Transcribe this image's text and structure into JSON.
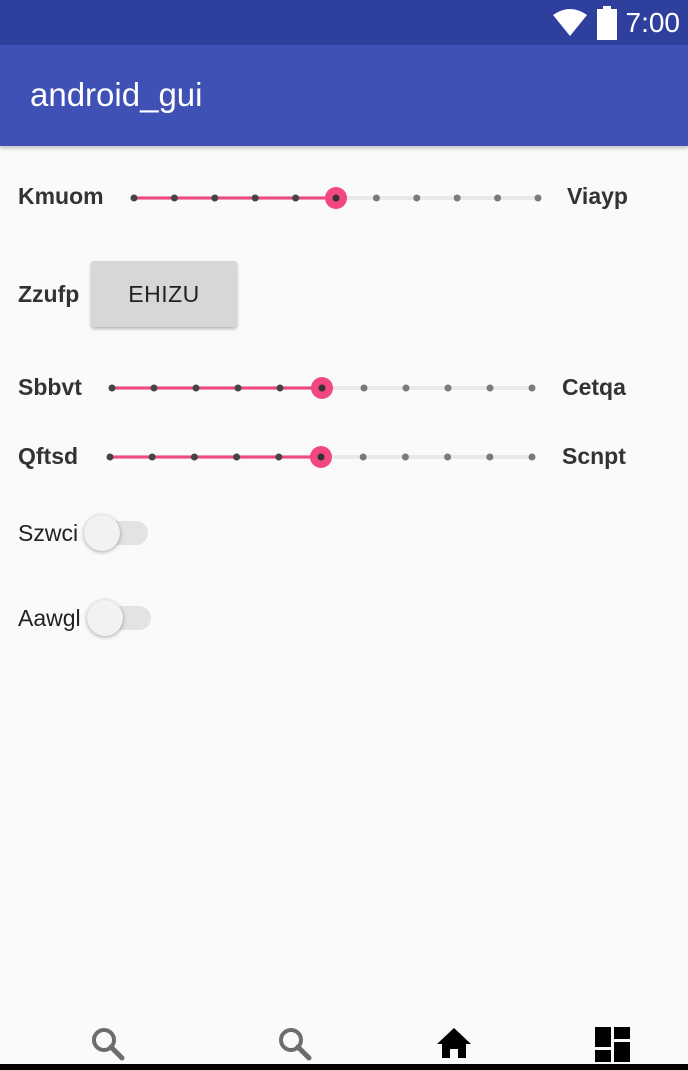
{
  "status_bar": {
    "time": "7:00",
    "icons": [
      "wifi-icon",
      "battery-icon"
    ]
  },
  "app_bar": {
    "title": "android_gui",
    "color": "#3f51b5"
  },
  "controls": {
    "slider_1": {
      "start_label": "Kmuom",
      "end_label": "Viayp",
      "steps": 10,
      "value": 5
    },
    "button_row": {
      "label": "Zzufp",
      "button_text": "EHIZU"
    },
    "slider_2": {
      "start_label": "Sbbvt",
      "end_label": "Cetqa",
      "steps": 10,
      "value": 5
    },
    "slider_3": {
      "start_label": "Qftsd",
      "end_label": "Scnpt",
      "steps": 10,
      "value": 5
    },
    "switch_1": {
      "label": "Szwci",
      "on": false
    },
    "switch_2": {
      "label": "Aawgl",
      "on": false
    }
  },
  "accent_color": "#f0487f",
  "bottom_nav": {
    "icons": [
      "search-icon",
      "search-icon",
      "home-icon",
      "dashboard-icon"
    ]
  }
}
